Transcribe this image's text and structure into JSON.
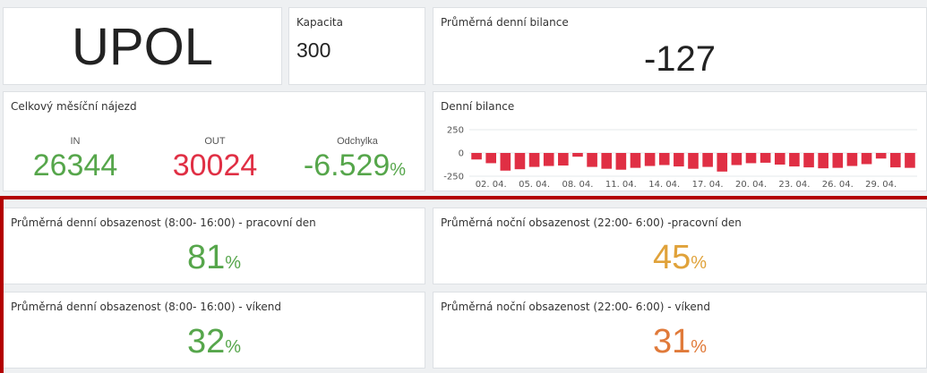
{
  "name_panel": {
    "value": "UPOL"
  },
  "capacity": {
    "title": "Kapacita",
    "value": "300"
  },
  "avg_balance": {
    "title": "Průměrná denní bilance",
    "value": "-127"
  },
  "monthly": {
    "title": "Celkový měsíční nájezd",
    "in_label": "IN",
    "in_value": "26344",
    "out_label": "OUT",
    "out_value": "30024",
    "dev_label": "Odchylka",
    "dev_value": "-6.529",
    "dev_unit": "%"
  },
  "daily_chart_title": "Denní bilance",
  "colors": {
    "green": "#56a64b",
    "red": "#e02f44",
    "amber": "#e0a23a",
    "orange": "#e07a3a",
    "bar": "#e02f44"
  },
  "occupancy": {
    "day_work": {
      "title": "Průměrná denní obsazenost (8:00- 16:00) - pracovní den",
      "value": "81",
      "unit": "%"
    },
    "night_work": {
      "title": "Průměrná noční obsazenost (22:00- 6:00) -pracovní den",
      "value": "45",
      "unit": "%"
    },
    "day_weekend": {
      "title": "Průměrná denní obsazenost (8:00- 16:00) - víkend",
      "value": "32",
      "unit": "%"
    },
    "night_weekend": {
      "title": "Průměrná noční obsazenost (22:00- 6:00) - víkend",
      "value": "31",
      "unit": "%"
    }
  },
  "chart_data": {
    "type": "bar",
    "title": "Denní bilance",
    "xlabel": "",
    "ylabel": "",
    "ylim": [
      -250,
      250
    ],
    "yticks": [
      250,
      0,
      -250
    ],
    "xtick_labels": [
      "02. 04.",
      "05. 04.",
      "08. 04.",
      "11. 04.",
      "14. 04.",
      "17. 04.",
      "20. 04.",
      "23. 04.",
      "26. 04.",
      "29. 04."
    ],
    "x_start": "2019-04-01",
    "values": [
      -70,
      -110,
      -190,
      -175,
      -150,
      -140,
      -135,
      -40,
      -150,
      -170,
      -180,
      -160,
      -140,
      -130,
      -145,
      -170,
      -150,
      -200,
      -130,
      -110,
      -105,
      -125,
      -145,
      -155,
      -165,
      -160,
      -140,
      -120,
      -60,
      -155,
      -160
    ]
  }
}
